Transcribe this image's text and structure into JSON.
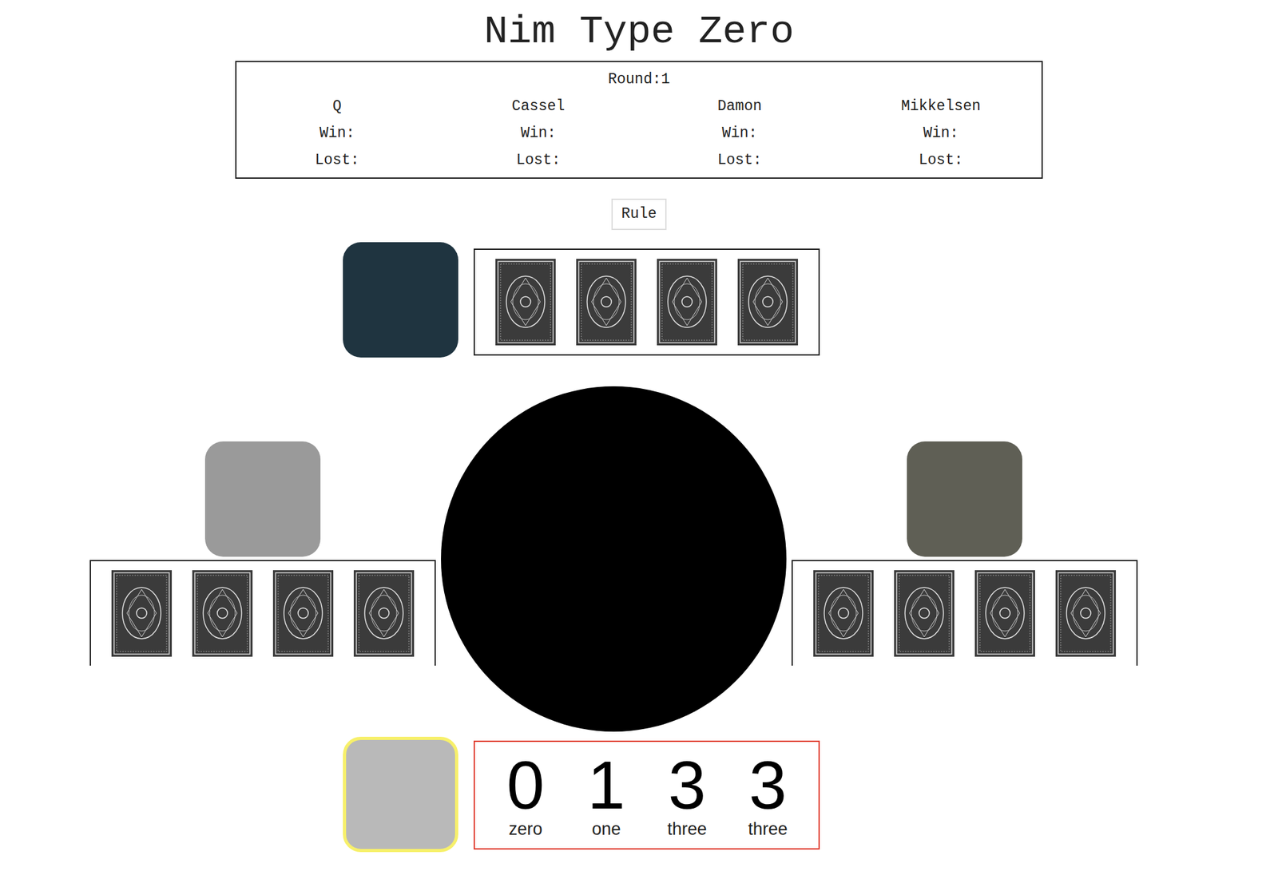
{
  "title": "Nim Type Zero",
  "scoreboard": {
    "round": "Round:1",
    "players": [
      {
        "name": "Q",
        "win": "Win:",
        "lost": "Lost:"
      },
      {
        "name": "Cassel",
        "win": "Win:",
        "lost": "Lost:"
      },
      {
        "name": "Damon",
        "win": "Win:",
        "lost": "Lost:"
      },
      {
        "name": "Mikkelsen",
        "win": "Win:",
        "lost": "Lost:"
      }
    ]
  },
  "rule_button": "Rule",
  "table": {
    "top": {
      "active": false,
      "cards": [
        {
          "hidden": true
        },
        {
          "hidden": true
        },
        {
          "hidden": true
        },
        {
          "hidden": true
        }
      ]
    },
    "left": {
      "active": false,
      "cards": [
        {
          "hidden": true
        },
        {
          "hidden": true
        },
        {
          "hidden": true
        },
        {
          "hidden": true
        }
      ]
    },
    "right": {
      "active": false,
      "cards": [
        {
          "hidden": true
        },
        {
          "hidden": true
        },
        {
          "hidden": true
        },
        {
          "hidden": true
        }
      ]
    },
    "bottom": {
      "active": true,
      "cards": [
        {
          "hidden": false,
          "value": "0",
          "label": "zero"
        },
        {
          "hidden": false,
          "value": "1",
          "label": "one"
        },
        {
          "hidden": false,
          "value": "3",
          "label": "three"
        },
        {
          "hidden": false,
          "value": "3",
          "label": "three"
        }
      ]
    }
  }
}
